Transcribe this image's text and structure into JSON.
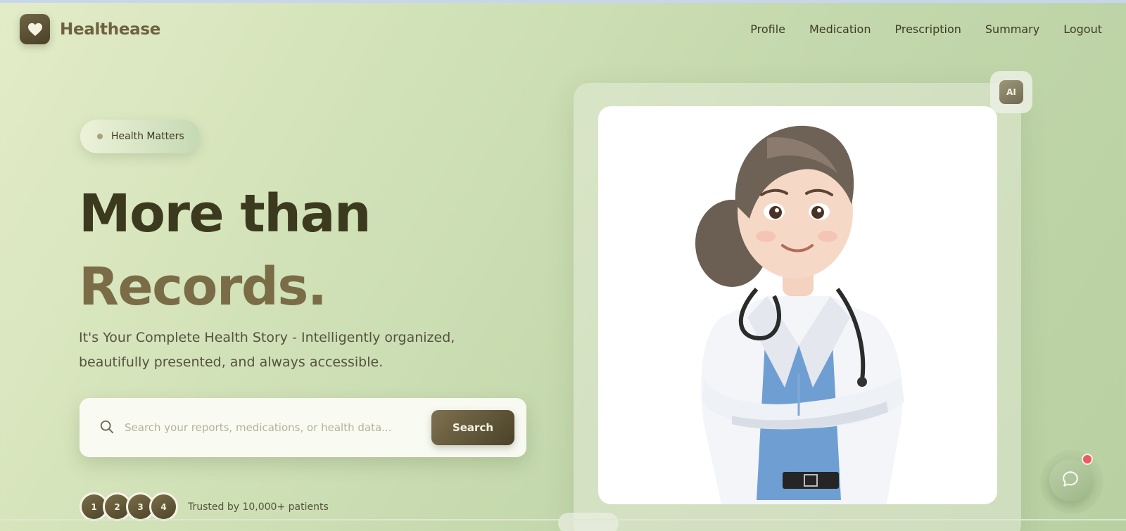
{
  "brand": {
    "name": "Healthease",
    "logo_icon": "heart-icon"
  },
  "nav": {
    "items": [
      "Profile",
      "Medication",
      "Prescription",
      "Summary",
      "Logout"
    ]
  },
  "hero": {
    "badge": "Health Matters",
    "headline_line1": "More than",
    "headline_line2": "Records.",
    "subtitle": "It's Your Complete Health Story - Intelligently organized, beautifully presented, and always accessible."
  },
  "search": {
    "placeholder": "Search your reports, medications, or health data...",
    "button_label": "Search",
    "icon": "search-icon"
  },
  "trust": {
    "avatars": [
      "1",
      "2",
      "3",
      "4"
    ],
    "text": "Trusted by 10,000+ patients"
  },
  "ai_badge": "AI",
  "chat": {
    "icon": "chat-bubble-icon",
    "notification": true
  },
  "colors": {
    "brand_dark": "#4a4128",
    "brand_olive": "#7a6c46",
    "background_light": "#e3ecc8",
    "background_green": "#b8d0a2",
    "notification_red": "#ec5b62"
  }
}
